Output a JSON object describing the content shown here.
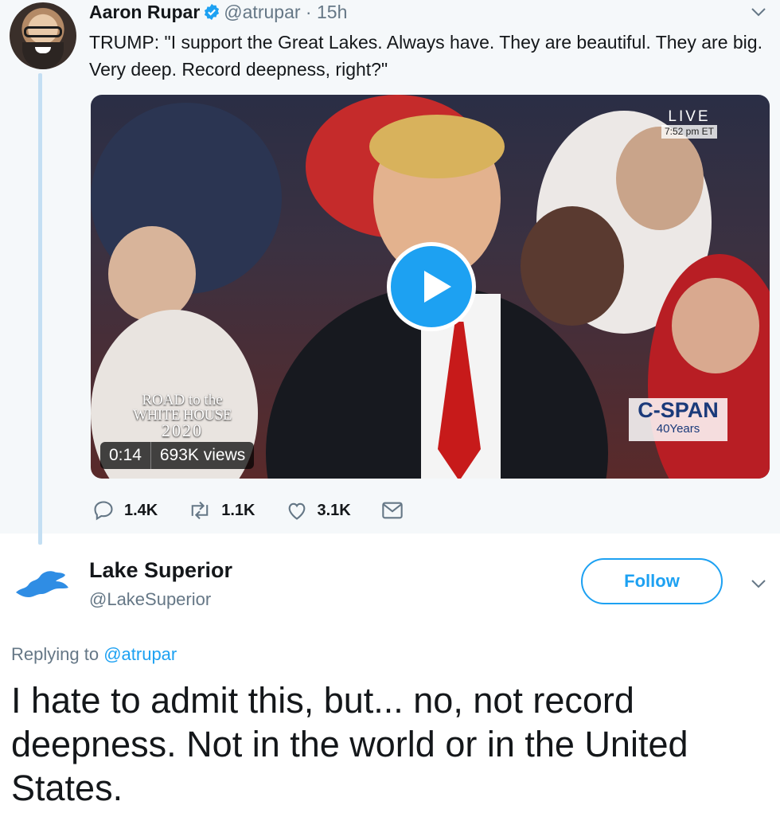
{
  "quoted_tweet": {
    "author_name": "Aaron Rupar",
    "author_handle": "@atrupar",
    "separator": "·",
    "time": "15h",
    "text": "TRUMP: \"I support the Great Lakes. Always have. They are beautiful. They are big. Very deep. Record deepness, right?\"",
    "video": {
      "live_label": "LIVE",
      "live_time": "7:52 pm ET",
      "overlay_lines": [
        "ROAD to the",
        "WHITE HOUSE",
        "2020"
      ],
      "network": "C-SPAN",
      "network_sub": "40Years",
      "duration": "0:14",
      "views": "693K views"
    },
    "stats": {
      "replies": "1.4K",
      "retweets": "1.1K",
      "likes": "3.1K"
    }
  },
  "reply_tweet": {
    "author_name": "Lake Superior",
    "author_handle": "@LakeSuperior",
    "follow_label": "Follow",
    "replying_prefix": "Replying to",
    "replying_to": "@atrupar",
    "text": "I hate to admit this, but... no, not record deepness. Not in the world or in the United States."
  },
  "colors": {
    "brand_blue": "#1da1f2",
    "secondary_text": "#657786",
    "quoted_bg": "#f5f8fa",
    "thread_line": "#c4dff3"
  },
  "icons": [
    "verified-badge-icon",
    "chevron-down-icon",
    "play-icon",
    "reply-icon",
    "retweet-icon",
    "like-icon",
    "direct-message-icon"
  ]
}
